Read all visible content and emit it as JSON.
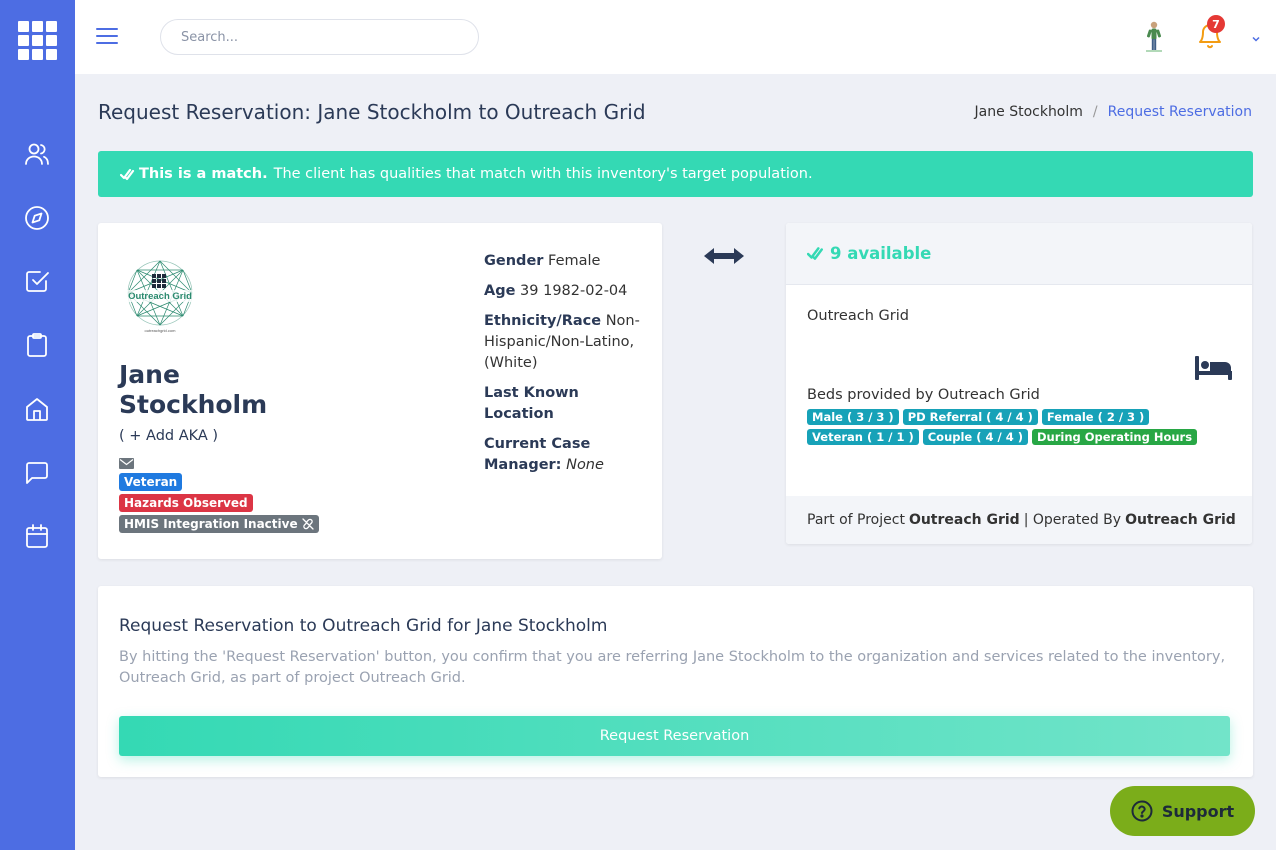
{
  "topbar": {
    "search_placeholder": "Search...",
    "notification_count": "7"
  },
  "header": {
    "title": "Request Reservation: Jane Stockholm to Outreach Grid",
    "breadcrumb": [
      "Jane Stockholm",
      "/",
      "Request Reservation"
    ]
  },
  "match": {
    "bold": "This is a match.",
    "text": "The client has qualities that match with this inventory's target population."
  },
  "client": {
    "logo_text": "Outreach Grid",
    "logo_subtext": "outreachgrid.com",
    "first_name": "Jane",
    "last_name": "Stockholm",
    "add_aka": "( + Add AKA )",
    "badges": {
      "veteran": "Veteran",
      "hazards": "Hazards Observed",
      "hmis": "HMIS Integration Inactive"
    },
    "gender_label": "Gender",
    "gender": "Female",
    "age_label": "Age",
    "age": "39 1982-02-04",
    "ethnicity_label": "Ethnicity/Race",
    "ethnicity": "Non-Hispanic/Non-Latino, (White)",
    "location_label": "Last Known Location",
    "manager_label": "Current Case Manager:",
    "manager": "None"
  },
  "inventory": {
    "available": "9 available",
    "name": "Outreach Grid",
    "beds_label": "Beds provided by Outreach Grid",
    "tags": [
      {
        "label": "Male ( 3 / 3 )",
        "color": "#17a2b8"
      },
      {
        "label": "PD Referral ( 4 / 4 )",
        "color": "#17a2b8"
      },
      {
        "label": "Female ( 2 / 3 )",
        "color": "#17a2b8"
      },
      {
        "label": "Veteran ( 1 / 1 )",
        "color": "#17a2b8"
      },
      {
        "label": "Couple ( 4 / 4 )",
        "color": "#17a2b8"
      },
      {
        "label": "During Operating Hours",
        "color": "#28a745"
      }
    ],
    "footer_prefix": "Part of Project",
    "project": "Outreach Grid",
    "footer_mid": "| Operated By",
    "operator": "Outreach Grid"
  },
  "request": {
    "title": "Request Reservation to Outreach Grid for Jane Stockholm",
    "text": "By hitting the 'Request Reservation' button, you confirm that you are referring Jane Stockholm to the organization and services related to the inventory, Outreach Grid, as part of project Outreach Grid.",
    "button": "Request Reservation"
  },
  "support": {
    "label": "Support"
  },
  "colors": {
    "sidebar": "#4d6de3",
    "accent": "#34d9b4",
    "support": "#7bad1a"
  }
}
